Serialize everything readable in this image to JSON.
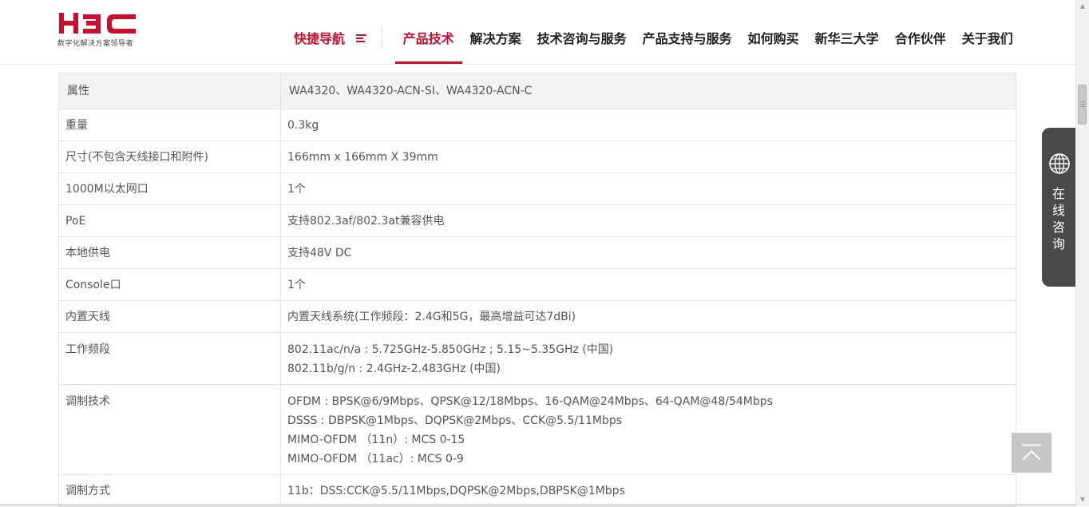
{
  "brand": {
    "logo_text": "H3C",
    "tagline": "数字化解决方案领导者",
    "accent_color": "#c8102e"
  },
  "nav": {
    "quick_nav": "快捷导航",
    "items": [
      {
        "label": "产品技术",
        "active": true
      },
      {
        "label": "解决方案"
      },
      {
        "label": "技术咨询与服务"
      },
      {
        "label": "产品支持与服务"
      },
      {
        "label": "如何购买"
      },
      {
        "label": "新华三大学"
      },
      {
        "label": "合作伙伴"
      },
      {
        "label": "关于我们"
      }
    ]
  },
  "spec_table": {
    "header": {
      "key": "属性",
      "value": "WA4320、WA4320-ACN-SI、WA4320-ACN-C"
    },
    "rows": [
      {
        "key": "重量",
        "lines": [
          "0.3kg"
        ]
      },
      {
        "key": "尺寸(不包含天线接口和附件)",
        "lines": [
          "166mm x 166mm X 39mm"
        ]
      },
      {
        "key": "1000M以太网口",
        "lines": [
          "1个"
        ]
      },
      {
        "key": "PoE",
        "lines": [
          "支持802.3af/802.3at兼容供电"
        ]
      },
      {
        "key": "本地供电",
        "lines": [
          "支持48V DC"
        ]
      },
      {
        "key": "Console口",
        "lines": [
          "1个"
        ]
      },
      {
        "key": "内置天线",
        "lines": [
          "内置天线系统(工作频段：2.4G和5G，最高增益可达7dBi)"
        ]
      },
      {
        "key": "工作频段",
        "lines": [
          "802.11ac/n/a : 5.725GHz-5.850GHz ; 5.15~5.35GHz (中国)",
          "802.11b/g/n : 2.4GHz-2.483GHz (中国)"
        ]
      },
      {
        "key": "调制技术",
        "lines": [
          "OFDM : BPSK@6/9Mbps、QPSK@12/18Mbps、16-QAM@24Mbps、64-QAM@48/54Mbps",
          "DSSS : DBPSK@1Mbps、DQPSK@2Mbps、CCK@5.5/11Mbps",
          "MIMO-OFDM （11n）: MCS 0-15",
          "MIMO-OFDM （11ac）: MCS 0-9"
        ]
      },
      {
        "key": "调制方式",
        "lines": [
          "11b：DSS:CCK@5.5/11Mbps,DQPSK@2Mbps,DBPSK@1Mbps"
        ]
      }
    ]
  },
  "consult": {
    "label": "在线咨询",
    "icon": "globe-icon"
  },
  "back_to_top": {
    "icon": "chevron-up-icon"
  }
}
